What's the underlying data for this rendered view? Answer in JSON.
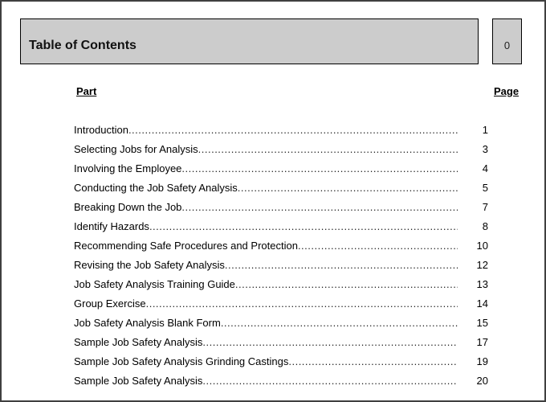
{
  "document": {
    "title": "Table of Contents",
    "page_number": "0",
    "columns": {
      "part": "Part",
      "page": "Page"
    },
    "entries": [
      {
        "label": "Introduction",
        "page": "1"
      },
      {
        "label": "Selecting Jobs for Analysis",
        "page": "3"
      },
      {
        "label": "Involving the Employee",
        "page": "4"
      },
      {
        "label": "Conducting the Job Safety Analysis",
        "page": "5"
      },
      {
        "label": "Breaking Down the Job",
        "page": "7"
      },
      {
        "label": "Identify Hazards",
        "page": "8"
      },
      {
        "label": "Recommending Safe Procedures and Protection",
        "page": "10"
      },
      {
        "label": "Revising the Job Safety Analysis",
        "page": "12"
      },
      {
        "label": "Job Safety Analysis Training Guide",
        "page": "13"
      },
      {
        "label": "Group Exercise",
        "page": "14"
      },
      {
        "label": "Job Safety Analysis Blank Form",
        "page": "15"
      },
      {
        "label": "Sample Job Safety Analysis",
        "page": "17"
      },
      {
        "label": "Sample Job Safety Analysis Grinding Castings",
        "page": "19"
      },
      {
        "label": "Sample Job Safety Analysis",
        "page": "20"
      }
    ]
  }
}
